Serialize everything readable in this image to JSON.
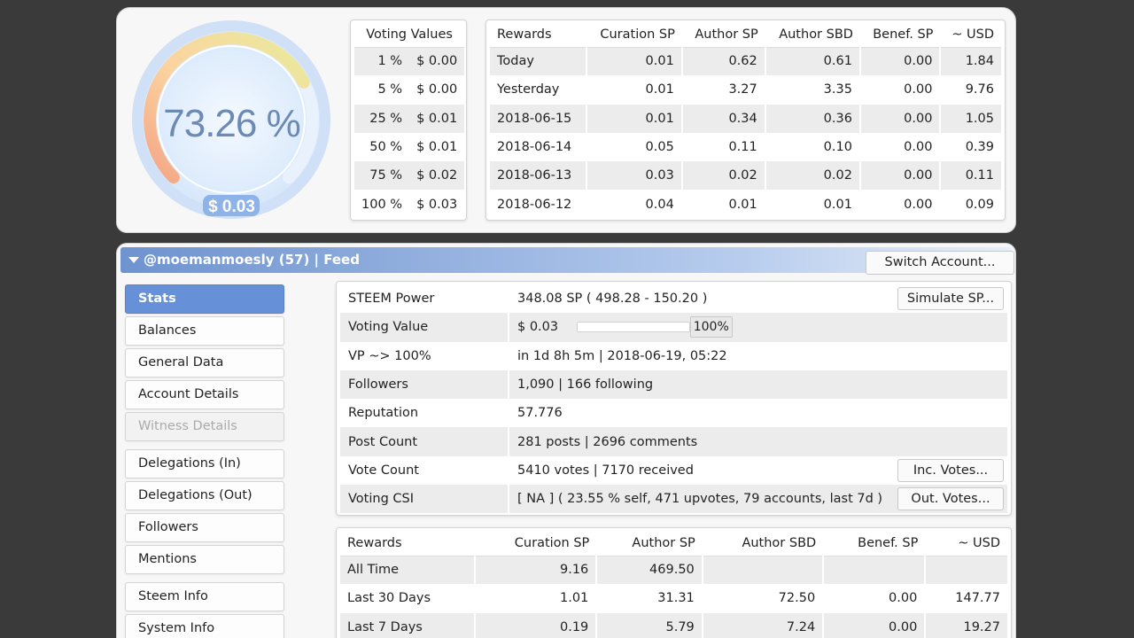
{
  "gauge": {
    "percent_text": "73.26 %",
    "usd_text": "$ 0.03",
    "value": 73.26
  },
  "voting_values": {
    "header": "Voting Values",
    "rows": [
      {
        "pct": "1 %",
        "val": "$ 0.00"
      },
      {
        "pct": "5 %",
        "val": "$ 0.00"
      },
      {
        "pct": "25 %",
        "val": "$ 0.01"
      },
      {
        "pct": "50 %",
        "val": "$ 0.01"
      },
      {
        "pct": "75 %",
        "val": "$ 0.02"
      },
      {
        "pct": "100 %",
        "val": "$ 0.03"
      }
    ]
  },
  "daily_rewards": {
    "headers": [
      "Rewards",
      "Curation SP",
      "Author SP",
      "Author SBD",
      "Benef. SP",
      "~ USD"
    ],
    "rows": [
      [
        "Today",
        "0.01",
        "0.62",
        "0.61",
        "0.00",
        "1.84"
      ],
      [
        "Yesterday",
        "0.01",
        "3.27",
        "3.35",
        "0.00",
        "9.76"
      ],
      [
        "2018-06-15",
        "0.01",
        "0.34",
        "0.36",
        "0.00",
        "1.05"
      ],
      [
        "2018-06-14",
        "0.05",
        "0.11",
        "0.10",
        "0.00",
        "0.39"
      ],
      [
        "2018-06-13",
        "0.03",
        "0.02",
        "0.02",
        "0.00",
        "0.11"
      ],
      [
        "2018-06-12",
        "0.04",
        "0.01",
        "0.01",
        "0.00",
        "0.09"
      ]
    ]
  },
  "account_bar": {
    "title": "@moemanmoesly (57)  |  Feed",
    "switch_label": "Switch Account..."
  },
  "sidebar": {
    "items": [
      {
        "label": "Stats",
        "state": "active"
      },
      {
        "label": "Balances",
        "state": "normal"
      },
      {
        "label": "General Data",
        "state": "normal"
      },
      {
        "label": "Account Details",
        "state": "normal"
      },
      {
        "label": "Witness Details",
        "state": "disabled"
      },
      {
        "label": "Delegations (In)",
        "state": "normal"
      },
      {
        "label": "Delegations (Out)",
        "state": "normal"
      },
      {
        "label": "Followers",
        "state": "normal"
      },
      {
        "label": "Mentions",
        "state": "normal"
      },
      {
        "label": "Steem Info",
        "state": "normal"
      },
      {
        "label": "System Info",
        "state": "normal"
      }
    ]
  },
  "stats": {
    "steem_power": {
      "label": "STEEM Power",
      "value": "348.08 SP ( 498.28 - 150.20 )",
      "button": "Simulate SP..."
    },
    "voting_value": {
      "label": "Voting Value",
      "value": "$ 0.03",
      "slider_label": "100%",
      "slider_level": 1.0
    },
    "vp": {
      "label": "VP ~> 100%",
      "value": "in 1d 8h 5m | 2018-06-19, 05:22"
    },
    "followers": {
      "label": "Followers",
      "value": "1,090 | 166 following"
    },
    "reputation": {
      "label": "Reputation",
      "value": "57.776"
    },
    "post_count": {
      "label": "Post Count",
      "value": "281 posts | 2696 comments"
    },
    "vote_count": {
      "label": "Vote Count",
      "value": "5410 votes | 7170 received",
      "button": "Inc. Votes..."
    },
    "voting_csi": {
      "label": "Voting CSI",
      "value": "[ NA ] ( 23.55 % self, 471 upvotes, 79 accounts, last 7d )",
      "button": "Out. Votes..."
    }
  },
  "summary_rewards": {
    "headers": [
      "Rewards",
      "Curation SP",
      "Author SP",
      "Author SBD",
      "Benef. SP",
      "~ USD"
    ],
    "rows": [
      [
        "All Time",
        "9.16",
        "469.50",
        "",
        "",
        ""
      ],
      [
        "Last 30 Days",
        "1.01",
        "31.31",
        "72.50",
        "0.00",
        "147.77"
      ],
      [
        "Last 7 Days",
        "0.19",
        "5.79",
        "7.24",
        "0.00",
        "19.27"
      ]
    ]
  },
  "colors": {
    "accent": "#6691d9",
    "page_bg": "#3a3a3a",
    "gauge_text": "#6b8ab5"
  }
}
